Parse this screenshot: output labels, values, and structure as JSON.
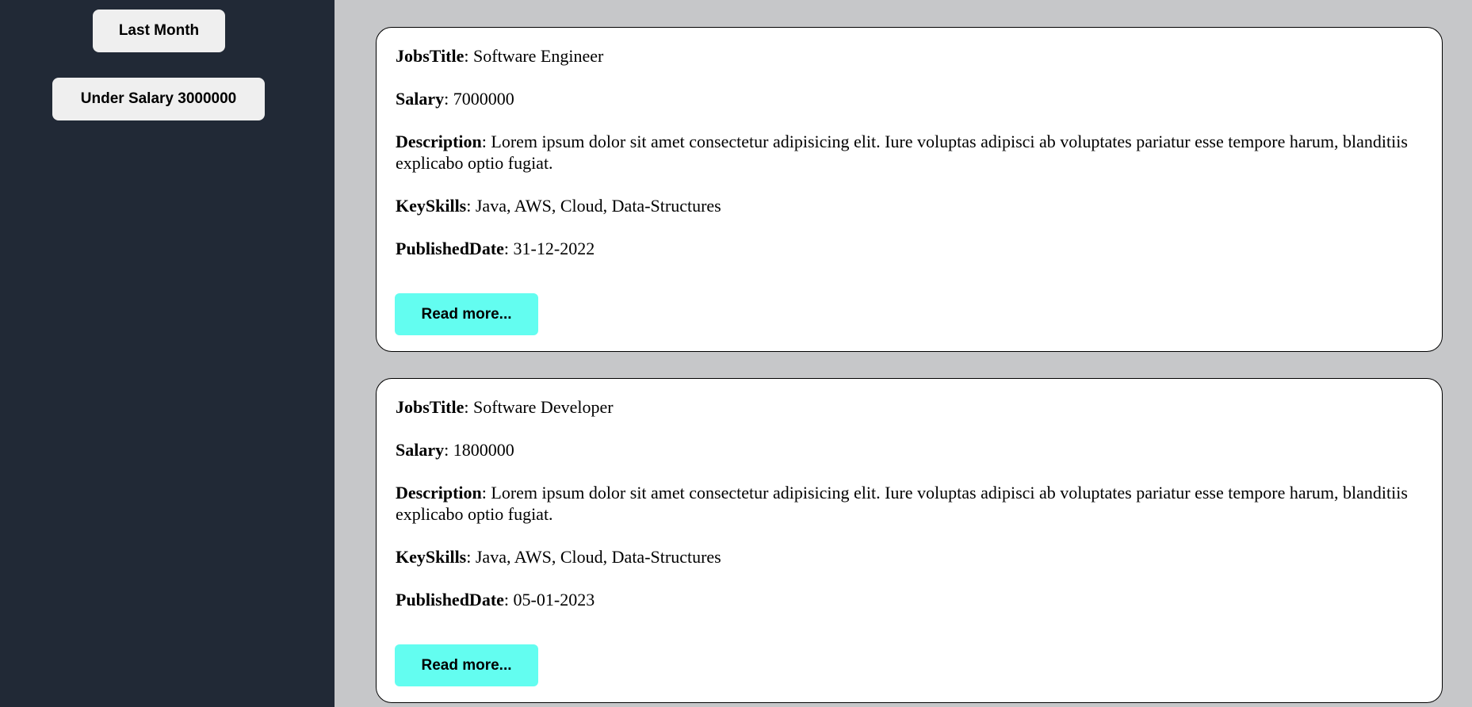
{
  "sidebar": {
    "buttons": [
      {
        "label": "Last Month"
      },
      {
        "label": "Under Salary 3000000"
      }
    ]
  },
  "labels": {
    "title": "JobsTitle",
    "salary": "Salary",
    "description": "Description",
    "skills": "KeySkills",
    "date": "PublishedDate",
    "separator": ": "
  },
  "jobs": [
    {
      "title": "Software Engineer",
      "salary": "7000000",
      "description": "Lorem ipsum dolor sit amet consectetur adipisicing elit. Iure voluptas adipisci ab voluptates pariatur esse tempore harum, blanditiis explicabo optio fugiat.",
      "skills": "Java, AWS, Cloud, Data-Structures",
      "date": "31-12-2022",
      "button": "Read more..."
    },
    {
      "title": "Software Developer",
      "salary": "1800000",
      "description": "Lorem ipsum dolor sit amet consectetur adipisicing elit. Iure voluptas adipisci ab voluptates pariatur esse tempore harum, blanditiis explicabo optio fugiat.",
      "skills": "Java, AWS, Cloud, Data-Structures",
      "date": "05-01-2023",
      "button": "Read more..."
    }
  ],
  "colors": {
    "sidebar_bg": "#212936",
    "page_bg": "#c6c7c9",
    "filter_button_bg": "#efefef",
    "read_more_bg": "#63fdf0"
  }
}
